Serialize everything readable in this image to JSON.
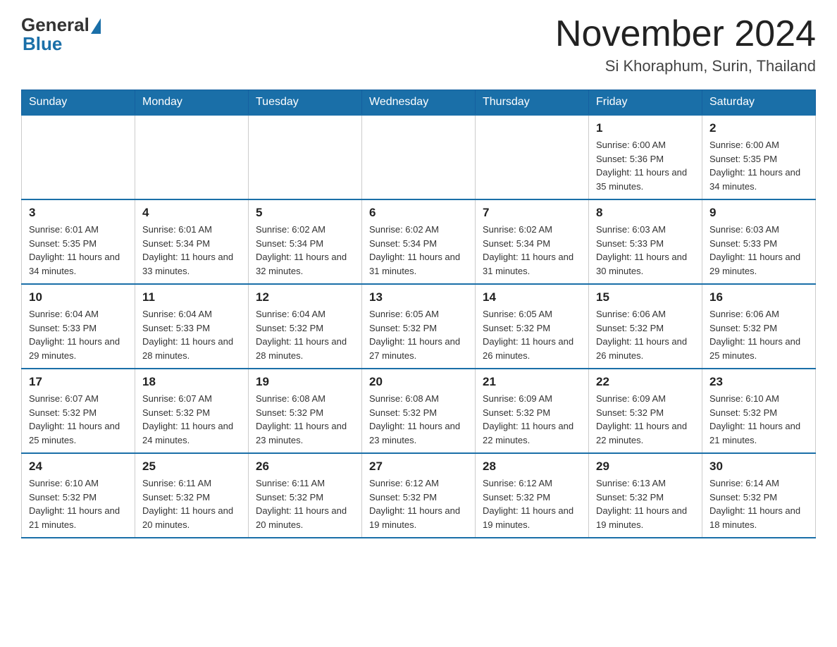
{
  "header": {
    "logo_general": "General",
    "logo_blue": "Blue",
    "month_title": "November 2024",
    "subtitle": "Si Khoraphum, Surin, Thailand"
  },
  "weekdays": [
    "Sunday",
    "Monday",
    "Tuesday",
    "Wednesday",
    "Thursday",
    "Friday",
    "Saturday"
  ],
  "weeks": [
    [
      {
        "day": "",
        "info": ""
      },
      {
        "day": "",
        "info": ""
      },
      {
        "day": "",
        "info": ""
      },
      {
        "day": "",
        "info": ""
      },
      {
        "day": "",
        "info": ""
      },
      {
        "day": "1",
        "info": "Sunrise: 6:00 AM\nSunset: 5:36 PM\nDaylight: 11 hours and 35 minutes."
      },
      {
        "day": "2",
        "info": "Sunrise: 6:00 AM\nSunset: 5:35 PM\nDaylight: 11 hours and 34 minutes."
      }
    ],
    [
      {
        "day": "3",
        "info": "Sunrise: 6:01 AM\nSunset: 5:35 PM\nDaylight: 11 hours and 34 minutes."
      },
      {
        "day": "4",
        "info": "Sunrise: 6:01 AM\nSunset: 5:34 PM\nDaylight: 11 hours and 33 minutes."
      },
      {
        "day": "5",
        "info": "Sunrise: 6:02 AM\nSunset: 5:34 PM\nDaylight: 11 hours and 32 minutes."
      },
      {
        "day": "6",
        "info": "Sunrise: 6:02 AM\nSunset: 5:34 PM\nDaylight: 11 hours and 31 minutes."
      },
      {
        "day": "7",
        "info": "Sunrise: 6:02 AM\nSunset: 5:34 PM\nDaylight: 11 hours and 31 minutes."
      },
      {
        "day": "8",
        "info": "Sunrise: 6:03 AM\nSunset: 5:33 PM\nDaylight: 11 hours and 30 minutes."
      },
      {
        "day": "9",
        "info": "Sunrise: 6:03 AM\nSunset: 5:33 PM\nDaylight: 11 hours and 29 minutes."
      }
    ],
    [
      {
        "day": "10",
        "info": "Sunrise: 6:04 AM\nSunset: 5:33 PM\nDaylight: 11 hours and 29 minutes."
      },
      {
        "day": "11",
        "info": "Sunrise: 6:04 AM\nSunset: 5:33 PM\nDaylight: 11 hours and 28 minutes."
      },
      {
        "day": "12",
        "info": "Sunrise: 6:04 AM\nSunset: 5:32 PM\nDaylight: 11 hours and 28 minutes."
      },
      {
        "day": "13",
        "info": "Sunrise: 6:05 AM\nSunset: 5:32 PM\nDaylight: 11 hours and 27 minutes."
      },
      {
        "day": "14",
        "info": "Sunrise: 6:05 AM\nSunset: 5:32 PM\nDaylight: 11 hours and 26 minutes."
      },
      {
        "day": "15",
        "info": "Sunrise: 6:06 AM\nSunset: 5:32 PM\nDaylight: 11 hours and 26 minutes."
      },
      {
        "day": "16",
        "info": "Sunrise: 6:06 AM\nSunset: 5:32 PM\nDaylight: 11 hours and 25 minutes."
      }
    ],
    [
      {
        "day": "17",
        "info": "Sunrise: 6:07 AM\nSunset: 5:32 PM\nDaylight: 11 hours and 25 minutes."
      },
      {
        "day": "18",
        "info": "Sunrise: 6:07 AM\nSunset: 5:32 PM\nDaylight: 11 hours and 24 minutes."
      },
      {
        "day": "19",
        "info": "Sunrise: 6:08 AM\nSunset: 5:32 PM\nDaylight: 11 hours and 23 minutes."
      },
      {
        "day": "20",
        "info": "Sunrise: 6:08 AM\nSunset: 5:32 PM\nDaylight: 11 hours and 23 minutes."
      },
      {
        "day": "21",
        "info": "Sunrise: 6:09 AM\nSunset: 5:32 PM\nDaylight: 11 hours and 22 minutes."
      },
      {
        "day": "22",
        "info": "Sunrise: 6:09 AM\nSunset: 5:32 PM\nDaylight: 11 hours and 22 minutes."
      },
      {
        "day": "23",
        "info": "Sunrise: 6:10 AM\nSunset: 5:32 PM\nDaylight: 11 hours and 21 minutes."
      }
    ],
    [
      {
        "day": "24",
        "info": "Sunrise: 6:10 AM\nSunset: 5:32 PM\nDaylight: 11 hours and 21 minutes."
      },
      {
        "day": "25",
        "info": "Sunrise: 6:11 AM\nSunset: 5:32 PM\nDaylight: 11 hours and 20 minutes."
      },
      {
        "day": "26",
        "info": "Sunrise: 6:11 AM\nSunset: 5:32 PM\nDaylight: 11 hours and 20 minutes."
      },
      {
        "day": "27",
        "info": "Sunrise: 6:12 AM\nSunset: 5:32 PM\nDaylight: 11 hours and 19 minutes."
      },
      {
        "day": "28",
        "info": "Sunrise: 6:12 AM\nSunset: 5:32 PM\nDaylight: 11 hours and 19 minutes."
      },
      {
        "day": "29",
        "info": "Sunrise: 6:13 AM\nSunset: 5:32 PM\nDaylight: 11 hours and 19 minutes."
      },
      {
        "day": "30",
        "info": "Sunrise: 6:14 AM\nSunset: 5:32 PM\nDaylight: 11 hours and 18 minutes."
      }
    ]
  ]
}
